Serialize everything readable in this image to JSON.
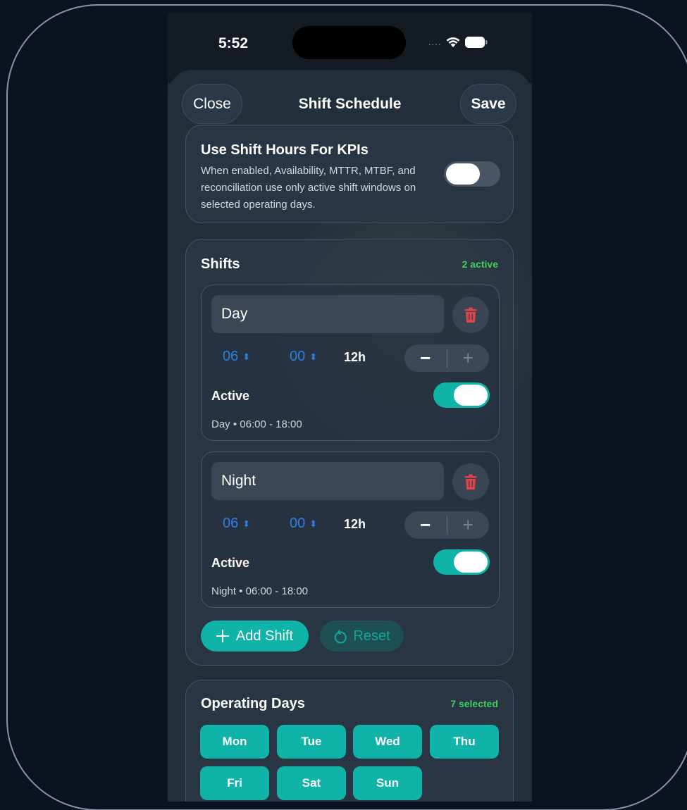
{
  "status": {
    "time": "5:52",
    "signal": "....",
    "wifi_icon": "wifi-icon",
    "battery_icon": "battery-icon"
  },
  "nav": {
    "close_label": "Close",
    "title": "Shift Schedule",
    "save_label": "Save"
  },
  "kpi": {
    "title": "Use Shift Hours For KPIs",
    "description": "When enabled, Availability, MTTR, MTBF, and reconciliation use only active shift windows on selected operating days.",
    "enabled": false
  },
  "shifts_section": {
    "title": "Shifts",
    "badge": "2 active",
    "shifts": [
      {
        "name": "Day",
        "start_hour": "06",
        "start_minute": "00",
        "duration": "12h",
        "active_label": "Active",
        "active": true,
        "summary": "Day • 06:00 - 18:00"
      },
      {
        "name": "Night",
        "start_hour": "06",
        "start_minute": "00",
        "duration": "12h",
        "active_label": "Active",
        "active": true,
        "summary": "Night • 06:00 - 18:00"
      }
    ],
    "add_label": "Add Shift",
    "reset_label": "Reset"
  },
  "days_section": {
    "title": "Operating Days",
    "badge": "7 selected",
    "days": [
      "Mon",
      "Tue",
      "Wed",
      "Thu",
      "Fri",
      "Sat",
      "Sun"
    ]
  },
  "colors": {
    "accent": "#0fb3a8",
    "badge_green": "#3fcf5f",
    "spinner_blue": "#2f7fe0",
    "delete_red": "#e2424a"
  }
}
